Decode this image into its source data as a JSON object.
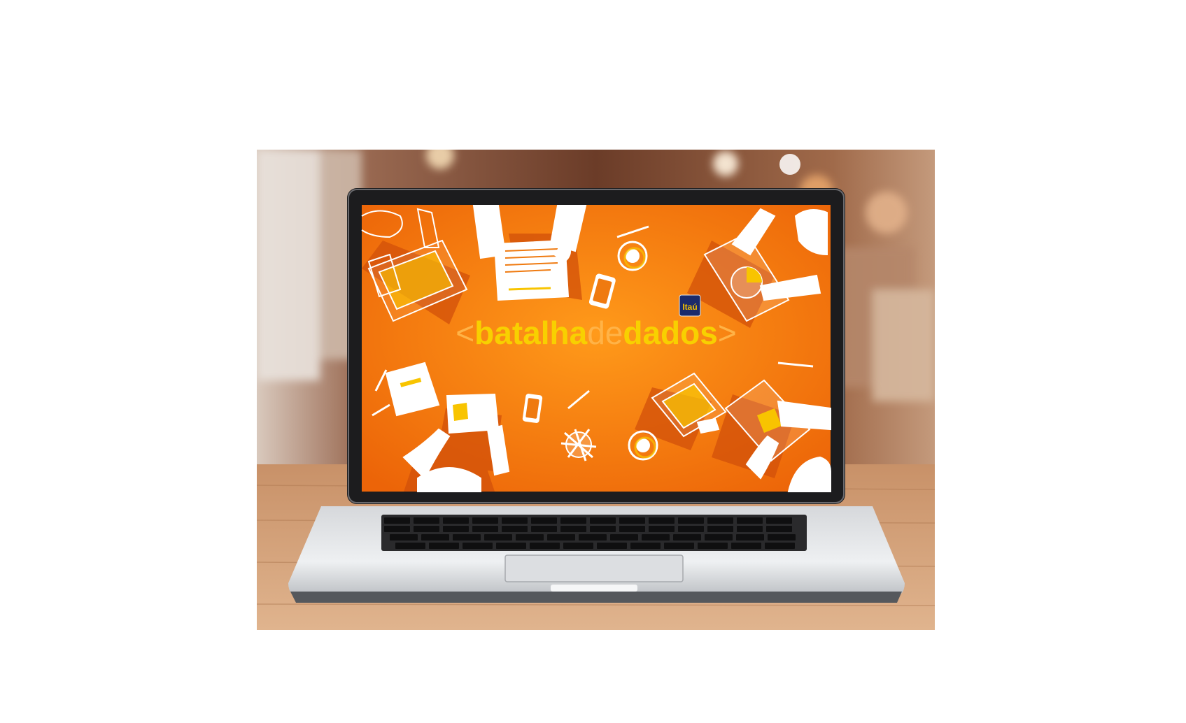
{
  "screen": {
    "logo": {
      "text": "Itaú",
      "bg": "#1b2a6b",
      "fg": "#f5c200"
    },
    "headline": {
      "bracket_open": "<",
      "part1": "batalha",
      "part2": "de",
      "part3": "dados",
      "bracket_close": ">"
    },
    "colors": {
      "accent": "#ef7a10",
      "yellow": "#f8c400"
    }
  }
}
